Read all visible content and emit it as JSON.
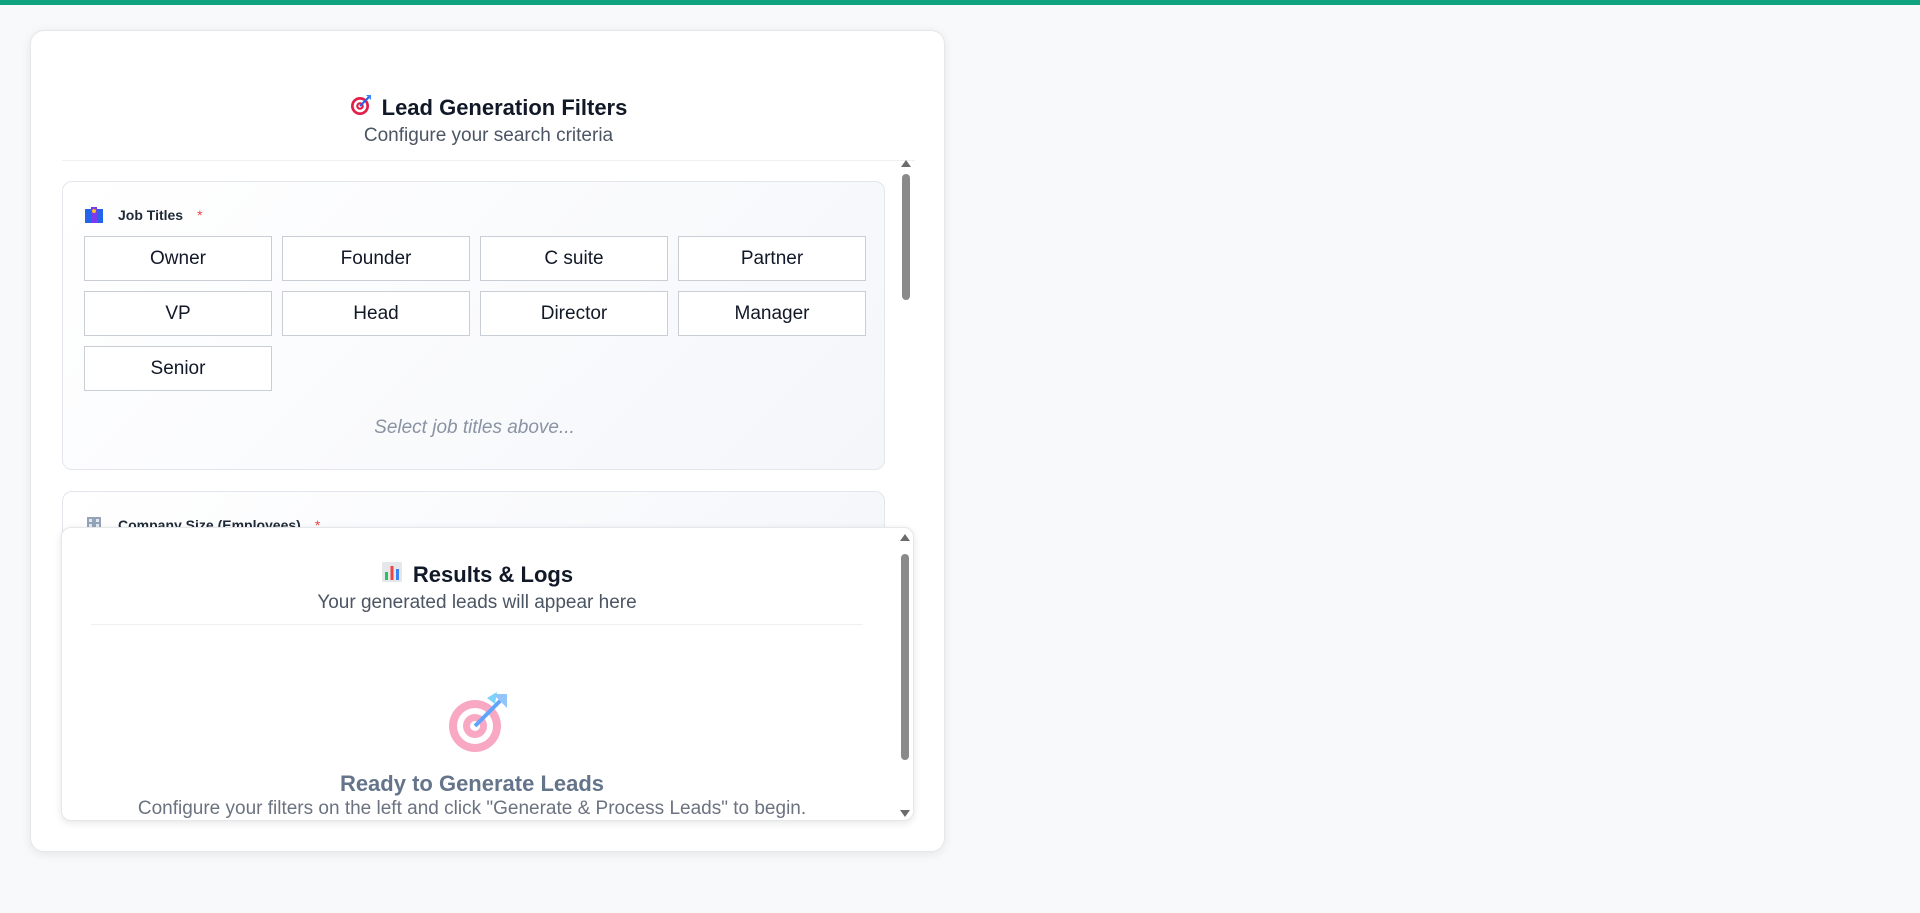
{
  "filters": {
    "title": "Lead Generation Filters",
    "subtitle": "Configure your search criteria",
    "title_icon": "target-dart-icon"
  },
  "job_titles": {
    "label": "Job Titles",
    "required_mark": "*",
    "icon": "people-group-icon",
    "options": [
      "Owner",
      "Founder",
      "C suite",
      "Partner",
      "VP",
      "Head",
      "Director",
      "Manager",
      "Senior"
    ],
    "placeholder": "Select job titles above..."
  },
  "company_size": {
    "label": "Company Size (Employees)",
    "required_mark": "*",
    "icon": "office-building-icon"
  },
  "results": {
    "title": "Results & Logs",
    "subtitle": "Your generated leads will appear here",
    "title_icon": "bar-chart-icon",
    "empty_icon": "target-dart-icon",
    "empty_title": "Ready to Generate Leads",
    "empty_description": "Configure your filters on the left and click \"Generate & Process Leads\" to begin."
  },
  "colors": {
    "accent_bar": "#10a37f",
    "required": "#ef4444"
  }
}
